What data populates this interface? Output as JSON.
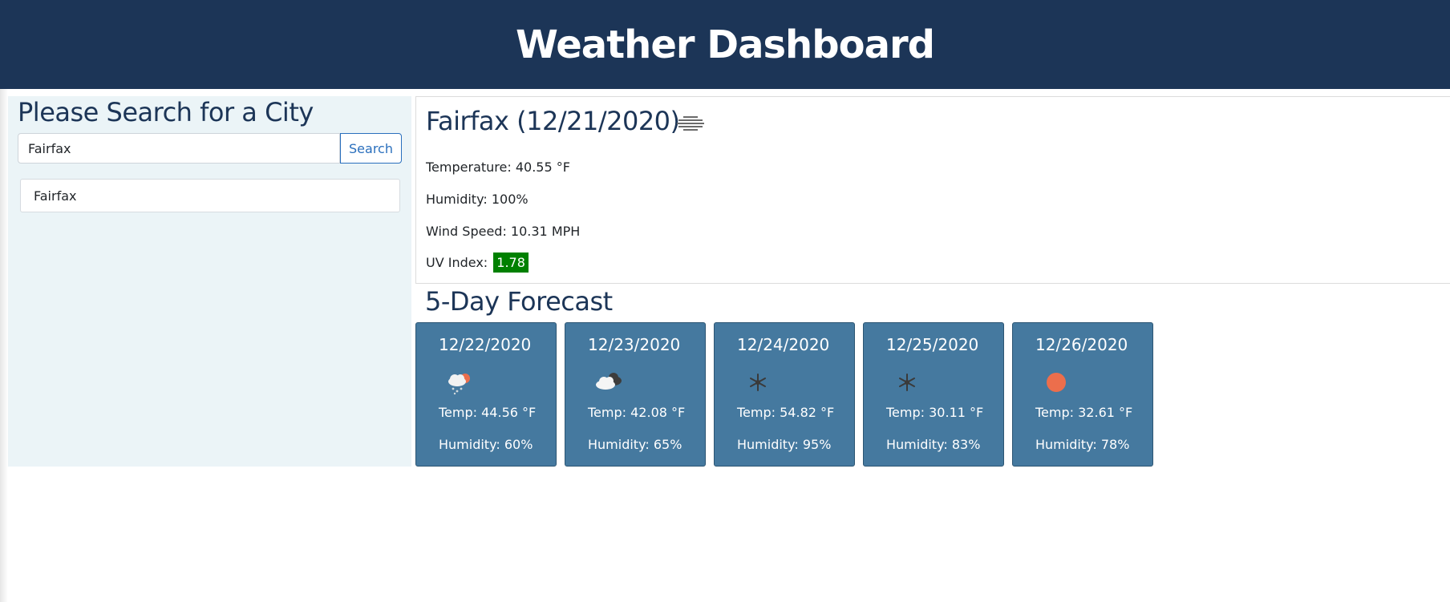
{
  "header": {
    "title": "Weather Dashboard"
  },
  "sidebar": {
    "title": "Please Search for a City",
    "search_value": "Fairfax",
    "search_button": "Search",
    "history": [
      "Fairfax"
    ]
  },
  "current": {
    "title": "Fairfax (12/21/2020)",
    "icon": "mist-icon",
    "temperature": "Temperature: 40.55 °F",
    "humidity": "Humidity: 100%",
    "wind": "Wind Speed: 10.31 MPH",
    "uv_label": "UV Index:",
    "uv_value": "1.78",
    "uv_color": "#008000"
  },
  "forecast": {
    "title": "5-Day Forecast",
    "days": [
      {
        "date": "12/22/2020",
        "icon": "snow-cloud-sun-icon",
        "temp": "Temp: 44.56 °F",
        "humidity": "Humidity: 60%"
      },
      {
        "date": "12/23/2020",
        "icon": "broken-clouds-icon",
        "temp": "Temp: 42.08 °F",
        "humidity": "Humidity: 65%"
      },
      {
        "date": "12/24/2020",
        "icon": "snowflake-icon",
        "temp": "Temp: 54.82 °F",
        "humidity": "Humidity: 95%"
      },
      {
        "date": "12/25/2020",
        "icon": "snowflake-icon",
        "temp": "Temp: 30.11 °F",
        "humidity": "Humidity: 83%"
      },
      {
        "date": "12/26/2020",
        "icon": "sun-icon",
        "temp": "Temp: 32.61 °F",
        "humidity": "Humidity: 78%"
      }
    ]
  },
  "colors": {
    "header_bg": "#1c3557",
    "card_bg": "#45799f",
    "sidebar_bg": "#ebf4f7",
    "sun": "#ec6e4c"
  }
}
